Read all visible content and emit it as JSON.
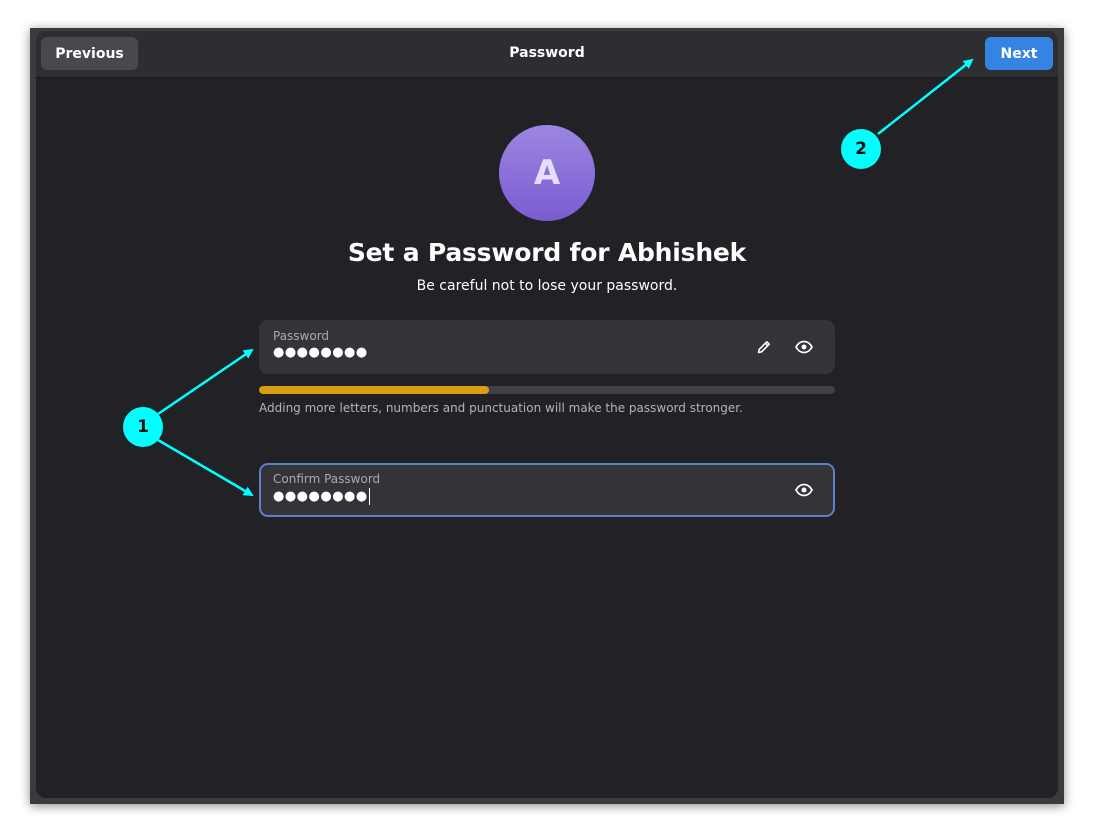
{
  "header": {
    "title": "Password",
    "previous_label": "Previous",
    "next_label": "Next"
  },
  "avatar": {
    "initial": "A"
  },
  "main": {
    "title": "Set a Password for Abhishek",
    "subtitle": "Be careful not to lose your password."
  },
  "password_field": {
    "label": "Password",
    "value": "●●●●●●●●",
    "icons": [
      "edit-icon",
      "eye-icon"
    ]
  },
  "strength": {
    "level": 0.4,
    "color": "#d99d12",
    "hint": "Adding more letters, numbers and punctuation will make the password stronger."
  },
  "confirm_field": {
    "label": "Confirm Password",
    "value": "●●●●●●●●",
    "icons": [
      "eye-icon"
    ]
  },
  "annotations": {
    "badge_1": "1",
    "badge_2": "2",
    "color": "#00ffff"
  },
  "colors": {
    "accent": "#3584e4",
    "window_bg": "#222226",
    "focus_border": "#5e7fc9"
  }
}
